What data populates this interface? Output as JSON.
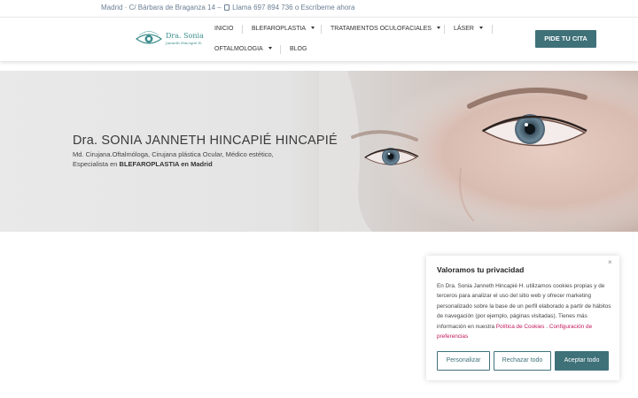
{
  "topbar": {
    "address": "Madrid · C/ Bárbara de Braganza 14 – ",
    "phone": "Llama 697 894 736 o Escríbeme ahora"
  },
  "logo": {
    "name": "Dra. Sonia",
    "subtitle": "Janneth Hincapié H."
  },
  "nav": {
    "items": [
      {
        "label": "INICIO",
        "dropdown": false
      },
      {
        "label": "BLEFAROPLASTIA",
        "dropdown": true
      },
      {
        "label": "TRATAMIENTOS OCULOFACIALES",
        "dropdown": true
      },
      {
        "label": "LÁSER",
        "dropdown": true
      },
      {
        "label": "OFTALMOLOGIA",
        "dropdown": true
      },
      {
        "label": "BLOG",
        "dropdown": false
      }
    ],
    "cta": "PIDE TU CITA"
  },
  "hero": {
    "title": "Dra. SONIA JANNETH HINCAPIÉ HINCAPIÉ",
    "line1": "Md. Cirujana.Oftalmóloga, Cirujana plástica Ocular, Médico estético,",
    "line2_prefix": "Especialista en ",
    "line2_bold": "BLEFAROPLASTIA en Madrid"
  },
  "cookie": {
    "title": "Valoramos tu privacidad",
    "body": "En Dra. Sonia Janneth Hincapié H. utilizamos cookies propias y de terceros para analizar el uso del sitio web y ofrecer marketing personalizado sobre la base de un perfil elaborado a partir de hábitos de navegación (por ejemplo, páginas visitadas). Tienes más información en nuestra ",
    "policy_link": "Política de Cookies",
    "separator": " . ",
    "prefs_link": "Configuración de preferencias",
    "close": "×",
    "buttons": {
      "customize": "Personalizar",
      "reject": "Rechazar todo",
      "accept": "Aceptar todo"
    }
  },
  "colors": {
    "primary": "#3f7179",
    "logo_teal": "#3d8e8d",
    "link_pink": "#c2185b",
    "topbar_text": "#6b7f95"
  }
}
